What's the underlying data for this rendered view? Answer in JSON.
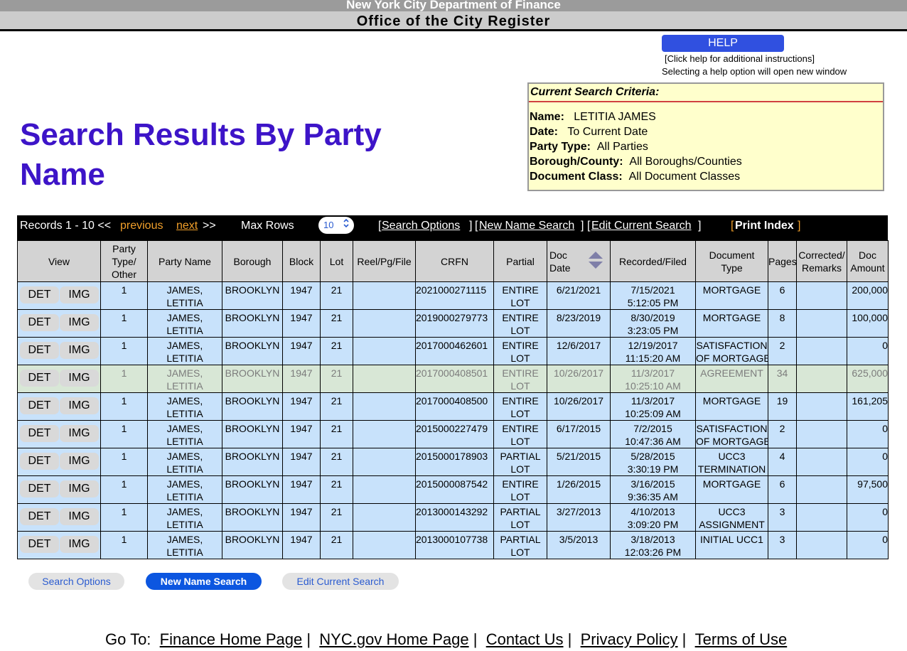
{
  "header": {
    "agency": "New York City Department of Finance",
    "office": "Office of the City Register"
  },
  "help": {
    "button_label": "HELP",
    "note1": "[Click help for additional instructions]",
    "note2": "Selecting a help option will open new window"
  },
  "page_title": "Search Results By Party Name",
  "criteria": {
    "heading": "Current Search Criteria:",
    "name_label": "Name:",
    "name_value": "LETITIA JAMES",
    "date_label": "Date:",
    "date_value": "To Current Date",
    "party_type_label": "Party Type:",
    "party_type_value": "All Parties",
    "borough_label": "Borough/County:",
    "borough_value": "All Boroughs/Counties",
    "doc_class_label": "Document Class:",
    "doc_class_value": "All Document Classes"
  },
  "bar": {
    "records": "Records 1 - 10 <<",
    "previous": "previous",
    "next": "next",
    "next_suffix": ">>",
    "max_rows_label": "Max Rows",
    "max_rows_value": "10",
    "max_rows_chevron": "⌃⌄",
    "bracket_open": "[",
    "bracket_close": "]",
    "search_options": "Search Options ",
    "new_name_search": "New Name Search",
    "edit_current_search": "Edit Current Search",
    "print_index": "Print Index"
  },
  "table": {
    "columns": {
      "view": "View",
      "party_type_l1": "Party",
      "party_type_l2": "Type/",
      "party_type_l3": "Other",
      "party_name": "Party Name",
      "borough": "Borough",
      "block": "Block",
      "lot": "Lot",
      "reel": "Reel/Pg/File",
      "crfn": "CRFN",
      "partial": "Partial",
      "doc_date_l1": "Doc",
      "doc_date_l2": "Date",
      "recorded": "Recorded/Filed",
      "doc_type_l1": "Document",
      "doc_type_l2": "Type",
      "pages": "Pages",
      "corrected_l1": "Corrected/",
      "corrected_l2": "Remarks",
      "amount_l1": "Doc",
      "amount_l2": "Amount"
    },
    "det_label": "DET",
    "img_label": "IMG",
    "rows": [
      {
        "type": "1",
        "name1": "JAMES,",
        "name2": "LETITIA",
        "borough": "BROOKLYN",
        "block": "1947",
        "lot": "21",
        "reel": "",
        "crfn": "2021000271115",
        "partial1": "ENTIRE",
        "partial2": "LOT",
        "doc_date": "6/21/2021",
        "rec1": "7/15/2021",
        "rec2": "5:12:05 PM",
        "dtype1": "MORTGAGE",
        "dtype2": "",
        "pages": "6",
        "remarks": "",
        "amount": "200,000"
      },
      {
        "type": "1",
        "name1": "JAMES,",
        "name2": "LETITIA",
        "borough": "BROOKLYN",
        "block": "1947",
        "lot": "21",
        "reel": "",
        "crfn": "2019000279773",
        "partial1": "ENTIRE",
        "partial2": "LOT",
        "doc_date": "8/23/2019",
        "rec1": "8/30/2019",
        "rec2": "3:23:05 PM",
        "dtype1": "MORTGAGE",
        "dtype2": "",
        "pages": "8",
        "remarks": "",
        "amount": "100,000"
      },
      {
        "type": "1",
        "name1": "JAMES,",
        "name2": "LETITIA",
        "borough": "BROOKLYN",
        "block": "1947",
        "lot": "21",
        "reel": "",
        "crfn": "2017000462601",
        "partial1": "ENTIRE",
        "partial2": "LOT",
        "doc_date": "12/6/2017",
        "rec1": "12/19/2017",
        "rec2": "11:15:20 AM",
        "dtype1": "SATISFACTION",
        "dtype2": "OF MORTGAGE",
        "pages": "2",
        "remarks": "",
        "amount": "0"
      },
      {
        "type": "1",
        "name1": "JAMES,",
        "name2": "LETITIA",
        "borough": "BROOKLYN",
        "block": "1947",
        "lot": "21",
        "reel": "",
        "crfn": "2017000408501",
        "partial1": "ENTIRE",
        "partial2": "LOT",
        "doc_date": "10/26/2017",
        "rec1": "11/3/2017",
        "rec2": "10:25:10 AM",
        "dtype1": "AGREEMENT",
        "dtype2": "",
        "pages": "34",
        "remarks": "",
        "amount": "625,000"
      },
      {
        "type": "1",
        "name1": "JAMES,",
        "name2": "LETITIA",
        "borough": "BROOKLYN",
        "block": "1947",
        "lot": "21",
        "reel": "",
        "crfn": "2017000408500",
        "partial1": "ENTIRE",
        "partial2": "LOT",
        "doc_date": "10/26/2017",
        "rec1": "11/3/2017",
        "rec2": "10:25:09 AM",
        "dtype1": "MORTGAGE",
        "dtype2": "",
        "pages": "19",
        "remarks": "",
        "amount": "161,205"
      },
      {
        "type": "1",
        "name1": "JAMES,",
        "name2": "LETITIA",
        "borough": "BROOKLYN",
        "block": "1947",
        "lot": "21",
        "reel": "",
        "crfn": "2015000227479",
        "partial1": "ENTIRE",
        "partial2": "LOT",
        "doc_date": "6/17/2015",
        "rec1": "7/2/2015",
        "rec2": "10:47:36 AM",
        "dtype1": "SATISFACTION",
        "dtype2": "OF MORTGAGE",
        "pages": "2",
        "remarks": "",
        "amount": "0"
      },
      {
        "type": "1",
        "name1": "JAMES,",
        "name2": "LETITIA",
        "borough": "BROOKLYN",
        "block": "1947",
        "lot": "21",
        "reel": "",
        "crfn": "2015000178903",
        "partial1": "PARTIAL",
        "partial2": "LOT",
        "doc_date": "5/21/2015",
        "rec1": "5/28/2015",
        "rec2": "3:30:19 PM",
        "dtype1": "UCC3",
        "dtype2": "TERMINATION",
        "pages": "4",
        "remarks": "",
        "amount": "0"
      },
      {
        "type": "1",
        "name1": "JAMES,",
        "name2": "LETITIA",
        "borough": "BROOKLYN",
        "block": "1947",
        "lot": "21",
        "reel": "",
        "crfn": "2015000087542",
        "partial1": "ENTIRE",
        "partial2": "LOT",
        "doc_date": "1/26/2015",
        "rec1": "3/16/2015",
        "rec2": "9:36:35 AM",
        "dtype1": "MORTGAGE",
        "dtype2": "",
        "pages": "6",
        "remarks": "",
        "amount": "97,500"
      },
      {
        "type": "1",
        "name1": "JAMES,",
        "name2": "LETITIA",
        "borough": "BROOKLYN",
        "block": "1947",
        "lot": "21",
        "reel": "",
        "crfn": "2013000143292",
        "partial1": "PARTIAL",
        "partial2": "LOT",
        "doc_date": "3/27/2013",
        "rec1": "4/10/2013",
        "rec2": "3:09:20 PM",
        "dtype1": "UCC3",
        "dtype2": "ASSIGNMENT",
        "pages": "3",
        "remarks": "",
        "amount": "0"
      },
      {
        "type": "1",
        "name1": "JAMES,",
        "name2": "LETITIA",
        "borough": "BROOKLYN",
        "block": "1947",
        "lot": "21",
        "reel": "",
        "crfn": "2013000107738",
        "partial1": "PARTIAL",
        "partial2": "LOT",
        "doc_date": "3/5/2013",
        "rec1": "3/18/2013",
        "rec2": "12:03:26 PM",
        "dtype1": "INITIAL UCC1",
        "dtype2": "",
        "pages": "3",
        "remarks": "",
        "amount": "0"
      }
    ]
  },
  "buttons": {
    "search_options": "Search Options",
    "new_name_search": "New Name Search",
    "edit_current_search": "Edit Current Search"
  },
  "footer": {
    "go_to": "Go To:",
    "finance_home": "Finance Home Page",
    "nyc_home": "NYC.gov Home Page",
    "contact": "Contact Us",
    "privacy": "Privacy Policy",
    "terms": "Terms of Use",
    "separator": "|"
  },
  "colors": {
    "title": "#3d14c8",
    "link_orange": "#f19f2a",
    "row_bg": "#c8e2fb",
    "criteria_bg": "#ffffcc",
    "primary_button": "#0c56e0"
  }
}
